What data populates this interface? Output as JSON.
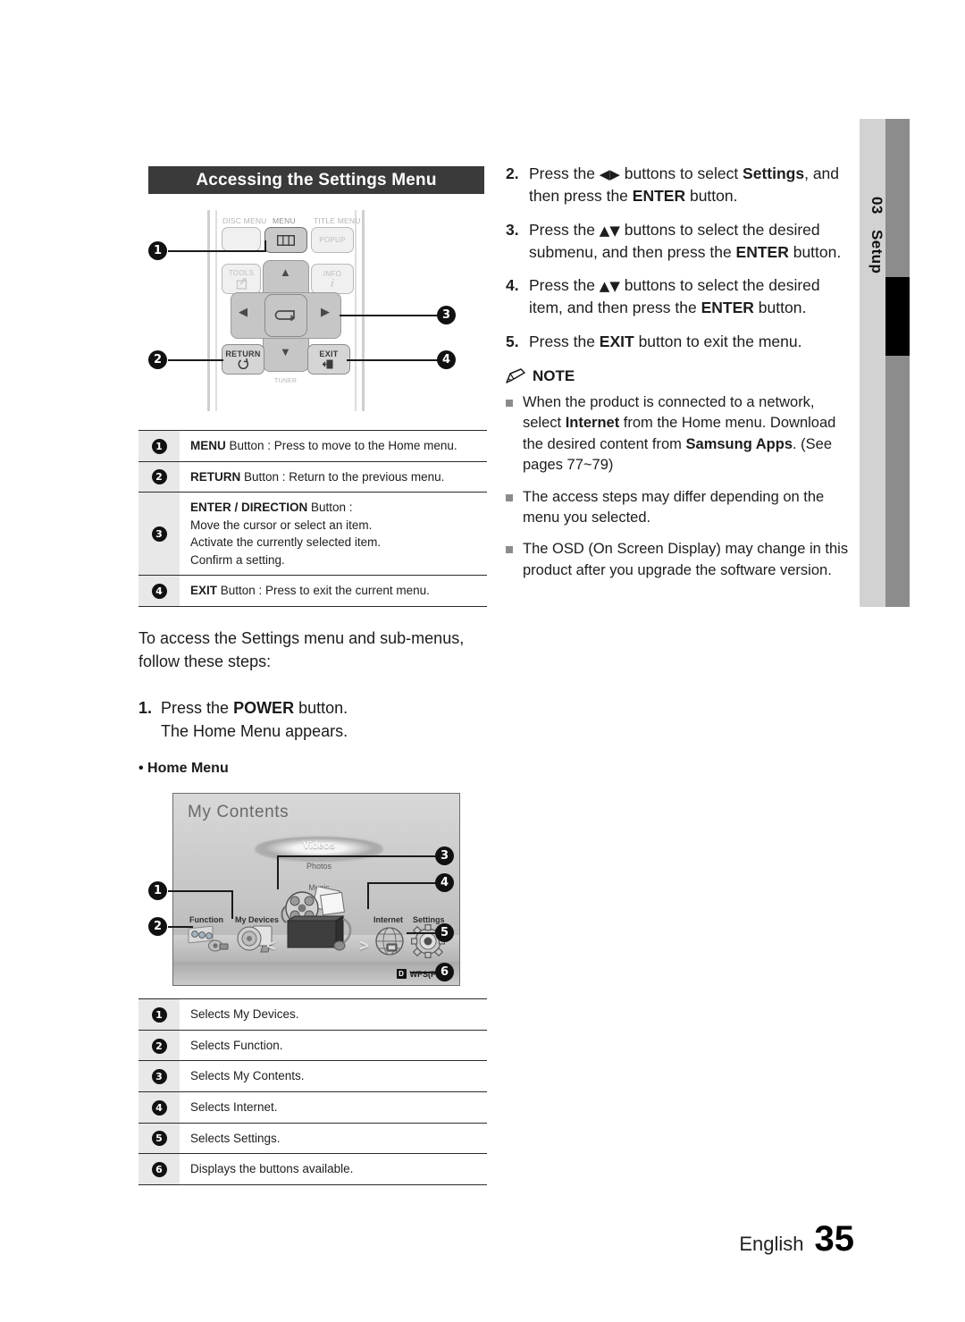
{
  "sidetab": {
    "chapter_number": "03",
    "chapter_label": "Setup"
  },
  "section": {
    "title": "Accessing the Settings Menu"
  },
  "remote": {
    "keys": [
      {
        "name": "disc-menu",
        "label": "DISC MENU"
      },
      {
        "name": "menu",
        "label": "MENU"
      },
      {
        "name": "title-menu",
        "label": "TITLE MENU"
      },
      {
        "name": "popup",
        "label": "POPUP"
      },
      {
        "name": "tools",
        "label": "TOOLS"
      },
      {
        "name": "info",
        "label": "INFO"
      },
      {
        "name": "return",
        "label": "RETURN"
      },
      {
        "name": "exit",
        "label": "EXIT"
      },
      {
        "name": "tuner",
        "label": "TUNER"
      }
    ],
    "markers": [
      "1",
      "2",
      "3",
      "4"
    ]
  },
  "remote_table": {
    "rows": [
      {
        "num": "1",
        "bold": "MENU",
        "rest": " Button : Press to move to the Home menu.",
        "lines": []
      },
      {
        "num": "2",
        "bold": "RETURN",
        "rest": " Button : Return to the previous menu.",
        "lines": []
      },
      {
        "num": "3",
        "bold": "ENTER / DIRECTION",
        "rest": " Button :",
        "lines": [
          "Move the cursor or select an item.",
          "Activate the currently selected item.",
          "Confirm a setting."
        ]
      },
      {
        "num": "4",
        "bold": "EXIT",
        "rest": " Button : Press to exit the current menu.",
        "lines": []
      }
    ]
  },
  "intro": {
    "paragraph": "To access the Settings menu and sub-menus, follow these steps:",
    "step1_num": "1.",
    "step1_pre": "Press the ",
    "step1_bold": "POWER",
    "step1_post": " button.",
    "step1_line2": "The Home Menu appears.",
    "home_menu_bullet": "• Home Menu"
  },
  "home_menu": {
    "title": "My Contents",
    "carousel": [
      "Videos",
      "Photos",
      "Music"
    ],
    "icons": [
      "Function",
      "My Devices",
      "Internet",
      "Settings"
    ],
    "wps_key": "D",
    "wps_label": "WPS(PBC)",
    "chevron_left": "<",
    "chevron_right": ">",
    "markers": [
      "1",
      "2",
      "3",
      "4",
      "5",
      "6"
    ]
  },
  "home_table": {
    "rows": [
      {
        "num": "1",
        "text": "Selects My Devices."
      },
      {
        "num": "2",
        "text": "Selects Function."
      },
      {
        "num": "3",
        "text": "Selects My Contents."
      },
      {
        "num": "4",
        "text": "Selects Internet."
      },
      {
        "num": "5",
        "text": "Selects Settings."
      },
      {
        "num": "6",
        "text": "Displays the buttons available."
      }
    ]
  },
  "steps": [
    {
      "num": "2.",
      "parts": [
        {
          "t": "Press the "
        },
        {
          "t": "◀▶",
          "arrows": true
        },
        {
          "t": " buttons to select "
        },
        {
          "t": "Settings",
          "b": true
        },
        {
          "t": ", and then press the "
        },
        {
          "t": "ENTER",
          "b": true
        },
        {
          "t": " button."
        }
      ]
    },
    {
      "num": "3.",
      "parts": [
        {
          "t": "Press the "
        },
        {
          "t": "▲▼",
          "arrows": true
        },
        {
          "t": " buttons to select the desired submenu, and then press the "
        },
        {
          "t": "ENTER",
          "b": true
        },
        {
          "t": " button."
        }
      ]
    },
    {
      "num": "4.",
      "parts": [
        {
          "t": "Press the "
        },
        {
          "t": "▲▼",
          "arrows": true
        },
        {
          "t": " buttons to select the desired item, and then press the "
        },
        {
          "t": "ENTER",
          "b": true
        },
        {
          "t": " button."
        }
      ]
    },
    {
      "num": "5.",
      "parts": [
        {
          "t": "Press the "
        },
        {
          "t": "EXIT",
          "b": true
        },
        {
          "t": " button to exit the menu."
        }
      ]
    }
  ],
  "note": {
    "heading": "NOTE",
    "items": [
      [
        {
          "t": "When the product is connected to a network, select "
        },
        {
          "t": "Internet",
          "b": true
        },
        {
          "t": " from the Home menu. Download the desired content from "
        },
        {
          "t": "Samsung Apps",
          "b": true
        },
        {
          "t": ". (See pages 77~79)"
        }
      ],
      [
        {
          "t": "The access steps may differ depending on the menu you selected."
        }
      ],
      [
        {
          "t": "The OSD (On Screen Display) may change in this product after you upgrade the software version."
        }
      ]
    ]
  },
  "footer": {
    "language": "English",
    "page_number": "35"
  }
}
